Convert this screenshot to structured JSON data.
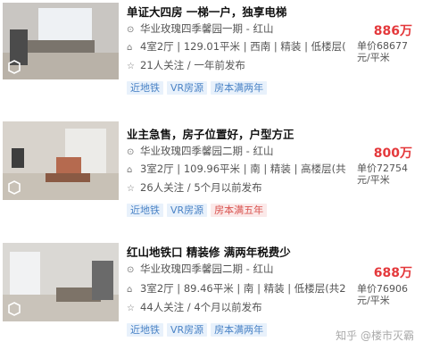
{
  "listings": [
    {
      "title": "单证大四房 一梯一户，独享电梯",
      "community": "华业玫瑰四季馨园一期 - 红山",
      "specs": "4室2厅 | 129.01平米 | 西南 | 精装 | 低楼层(",
      "follow": "21人关注 / 一年前发布",
      "price": "886万",
      "unit_price_line1": "单价68677",
      "unit_price_line2": "元/平米",
      "tags": [
        {
          "label": "近地铁",
          "style": "blue"
        },
        {
          "label": "VR房源",
          "style": "blue"
        },
        {
          "label": "房本满两年",
          "style": "blue"
        }
      ]
    },
    {
      "title": "业主急售，房子位置好，户型方正",
      "community": "华业玫瑰四季馨园二期 - 红山",
      "specs": "3室2厅 | 109.96平米 | 南 | 精装 | 高楼层(共",
      "follow": "26人关注 / 5个月以前发布",
      "price": "800万",
      "unit_price_line1": "单价72754",
      "unit_price_line2": "元/平米",
      "tags": [
        {
          "label": "近地铁",
          "style": "blue"
        },
        {
          "label": "VR房源",
          "style": "blue"
        },
        {
          "label": "房本满五年",
          "style": "red"
        }
      ]
    },
    {
      "title": "红山地铁口 精装修 满两年税费少",
      "community": "华业玫瑰四季馨园二期 - 红山",
      "specs": "3室2厅 | 89.46平米 | 南 | 精装 | 低楼层(共2",
      "follow": "44人关注 / 4个月以前发布",
      "price": "688万",
      "unit_price_line1": "单价76906",
      "unit_price_line2": "元/平米",
      "tags": [
        {
          "label": "近地铁",
          "style": "blue"
        },
        {
          "label": "VR房源",
          "style": "blue"
        },
        {
          "label": "房本满两年",
          "style": "blue"
        }
      ]
    }
  ],
  "watermark": "知乎 @楼市灭霸"
}
